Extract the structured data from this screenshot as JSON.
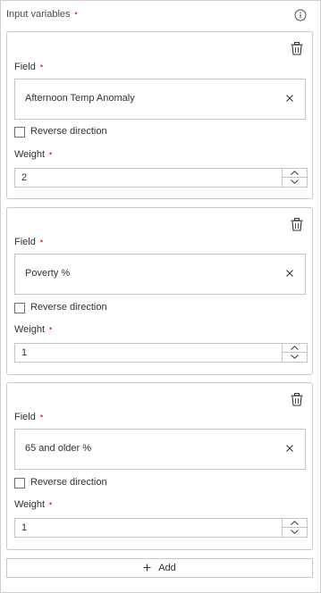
{
  "header": {
    "title": "Input variables",
    "required_marker": "•",
    "info_icon": "info-icon"
  },
  "labels": {
    "field": "Field",
    "reverse": "Reverse direction",
    "weight": "Weight",
    "required_marker": "•"
  },
  "variables": [
    {
      "field_value": "Afternoon Temp Anomaly",
      "reverse_checked": false,
      "weight": "2"
    },
    {
      "field_value": "Poverty %",
      "reverse_checked": false,
      "weight": "1"
    },
    {
      "field_value": "65 and older %",
      "reverse_checked": false,
      "weight": "1"
    }
  ],
  "add_button": {
    "label": "Add",
    "icon": "plus-icon"
  },
  "colors": {
    "required": "#d83020",
    "border": "#cacaca",
    "text": "#323232"
  },
  "icons": [
    "info-icon",
    "trash-icon",
    "close-icon",
    "chevron-up-icon",
    "chevron-down-icon",
    "plus-icon"
  ]
}
